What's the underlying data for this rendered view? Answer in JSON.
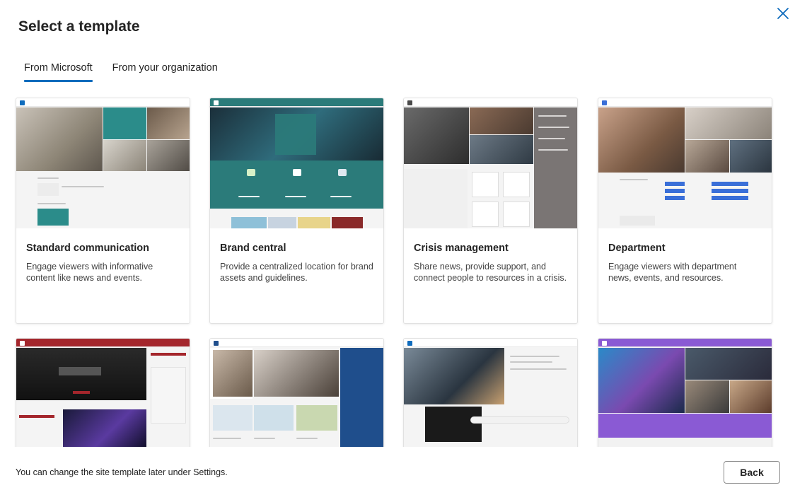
{
  "dialog": {
    "title": "Select a template",
    "close_icon": "close-icon"
  },
  "tabs": [
    {
      "label": "From Microsoft",
      "active": true
    },
    {
      "label": "From your organization",
      "active": false
    }
  ],
  "templates": [
    {
      "title": "Standard communication",
      "description": "Engage viewers with informative content like news and events.",
      "accent": "#0f6cbd"
    },
    {
      "title": "Brand central",
      "description": "Provide a centralized location for brand assets and guidelines.",
      "accent": "#2b7b7a"
    },
    {
      "title": "Crisis management",
      "description": "Share news, provide support, and connect people to resources in a crisis.",
      "accent": "#4a4a4a"
    },
    {
      "title": "Department",
      "description": "Engage viewers with department news, events, and resources.",
      "accent": "#3a6fd8"
    },
    {
      "title": "",
      "description": "",
      "accent": "#a4262c"
    },
    {
      "title": "",
      "description": "",
      "accent": "#1f4e8c"
    },
    {
      "title": "",
      "description": "",
      "accent": "#0f6cbd"
    },
    {
      "title": "",
      "description": "",
      "accent": "#8a5ad4"
    }
  ],
  "footer": {
    "note": "You can change the site template later under Settings.",
    "back_label": "Back"
  }
}
